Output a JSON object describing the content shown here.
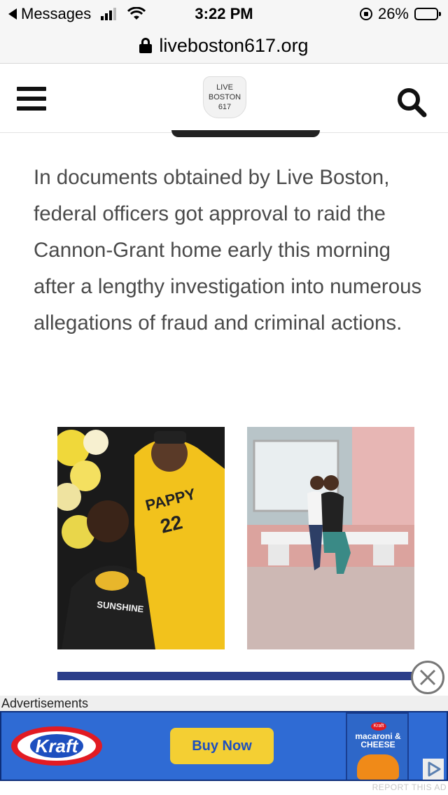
{
  "status_bar": {
    "back_label": "Messages",
    "time": "3:22 PM",
    "battery": "26%",
    "battery_level": 0.26
  },
  "address_bar": {
    "url": "liveboston617.org"
  },
  "site_header": {
    "logo_lines": [
      "LIVE",
      "BOSTON",
      "617"
    ]
  },
  "article": {
    "paragraph": "In documents obtained by Live Boston, federal officers got approval to raid the Cannon-Grant home early this morning after a lengthy investigation into numerous allegations of fraud and criminal actions.",
    "photos": [
      {
        "name": "photo-couple-yellow-jersey",
        "texts": [
          "PAPPY",
          "22",
          "SUNSHINE"
        ]
      },
      {
        "name": "photo-couple-on-bench",
        "texts": []
      }
    ]
  },
  "advertisement": {
    "label": "Advertisements",
    "brand": "Kraft",
    "cta": "Buy Now",
    "product_lines": [
      "macaroni &",
      "CHEESE"
    ],
    "product_brand": "Kraft",
    "report_label": "REPORT THIS AD"
  },
  "colors": {
    "ad_background": "#2f6bd4",
    "cta_background": "#f4cf33",
    "brand_red": "#e21b23",
    "article_text": "#4a4a4a"
  }
}
